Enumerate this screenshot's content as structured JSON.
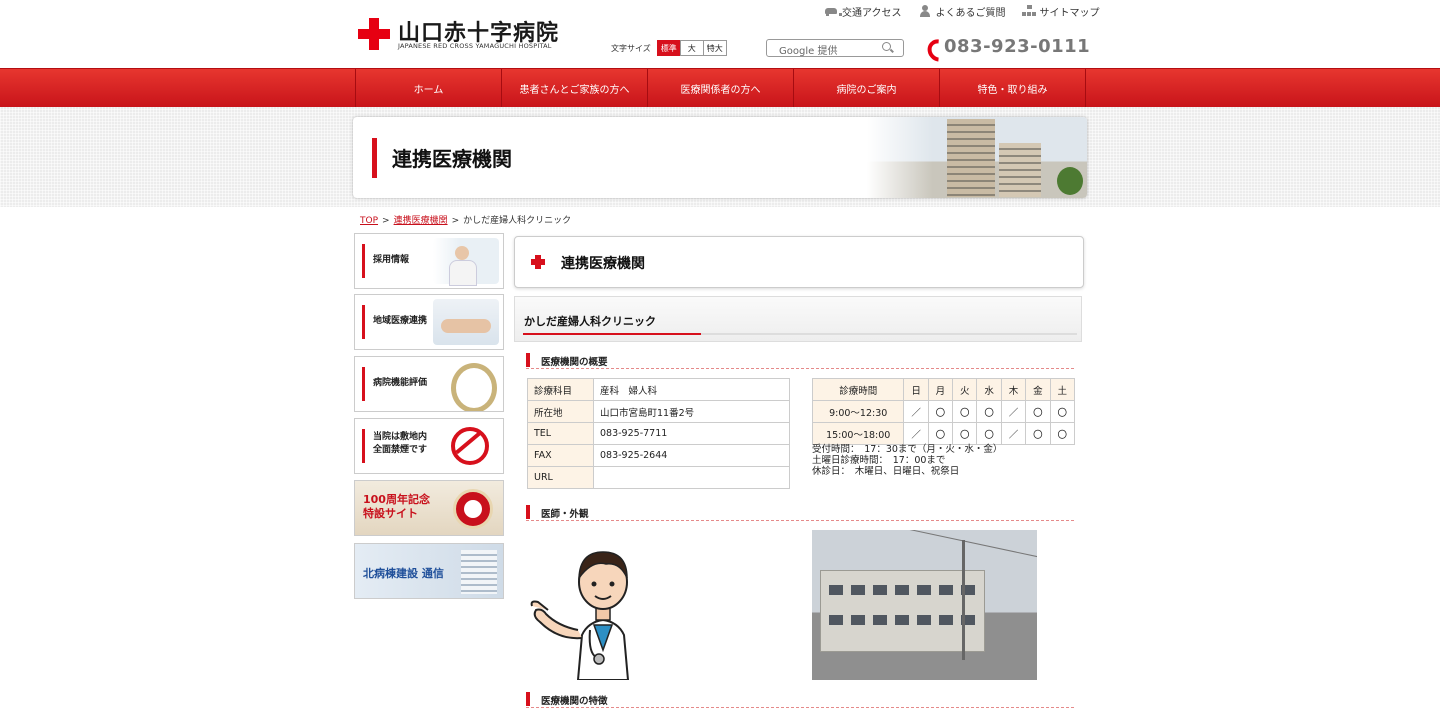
{
  "header": {
    "logo_title": "山口赤十字病院",
    "logo_subtitle": "JAPANESE RED CROSS YAMAGUCHI HOSPITAL",
    "util_links": [
      {
        "label": "交通アクセス",
        "icon": "car-icon"
      },
      {
        "label": "よくあるご質問",
        "icon": "person-icon"
      },
      {
        "label": "サイトマップ",
        "icon": "sitemap-icon"
      }
    ],
    "font_size_label": "文字サイズ",
    "font_sizes": [
      "標準",
      "大",
      "特大"
    ],
    "font_size_selected": "標準",
    "search_placeholder": "Google 提供",
    "phone": "083-923-0111"
  },
  "nav": {
    "items": [
      "ホーム",
      "患者さんとご家族の方へ",
      "医療関係者の方へ",
      "病院のご案内",
      "特色・取り組み"
    ]
  },
  "page_title": "連携医療機関",
  "breadcrumb": {
    "home": "TOP",
    "parent": "連携医療機関",
    "current": "かしだ産婦人科クリニック",
    "separator": ">"
  },
  "sidebar": {
    "recruit": "採用情報",
    "regional": "地域医療連携",
    "evaluation": "病院機能評価",
    "nosmoking_1": "当院は敷地内",
    "nosmoking_2": "全面禁煙です",
    "anniv_1": "100周年記念",
    "anniv_2": "特設サイト",
    "north": "北病棟建設 通信"
  },
  "main": {
    "heading": "連携医療機関",
    "clinic_name": "かしだ産婦人科クリニック",
    "section_overview": "医療機関の概要",
    "section_doctor": "医師・外観",
    "section_features": "医療機関の特徴",
    "info": [
      {
        "label": "診療科目",
        "value": "産科　婦人科"
      },
      {
        "label": "所在地",
        "value": "山口市宮島町11番2号"
      },
      {
        "label": "TEL",
        "value": "083-925-7711"
      },
      {
        "label": "FAX",
        "value": "083-925-2644"
      },
      {
        "label": "URL",
        "value": ""
      }
    ],
    "hours": {
      "header": "診療時間",
      "days": [
        "日",
        "月",
        "火",
        "水",
        "木",
        "金",
        "土"
      ],
      "rows": [
        {
          "time": "9:00～12:30",
          "marks": [
            "／",
            "〇",
            "〇",
            "〇",
            "／",
            "〇",
            "〇"
          ]
        },
        {
          "time": "15:00～18:00",
          "marks": [
            "／",
            "〇",
            "〇",
            "〇",
            "／",
            "〇",
            "〇"
          ]
        }
      ],
      "notes": [
        "受付時間：　17：30まで（月・火・水・金）",
        "土曜日診療時間：　17：00まで",
        "休診日：　木曜日、日曜日、祝祭日"
      ]
    }
  },
  "colors": {
    "brand_red": "#d7101c",
    "nav_red": "#e7362f",
    "table_key_bg": "#fdf3e6"
  }
}
